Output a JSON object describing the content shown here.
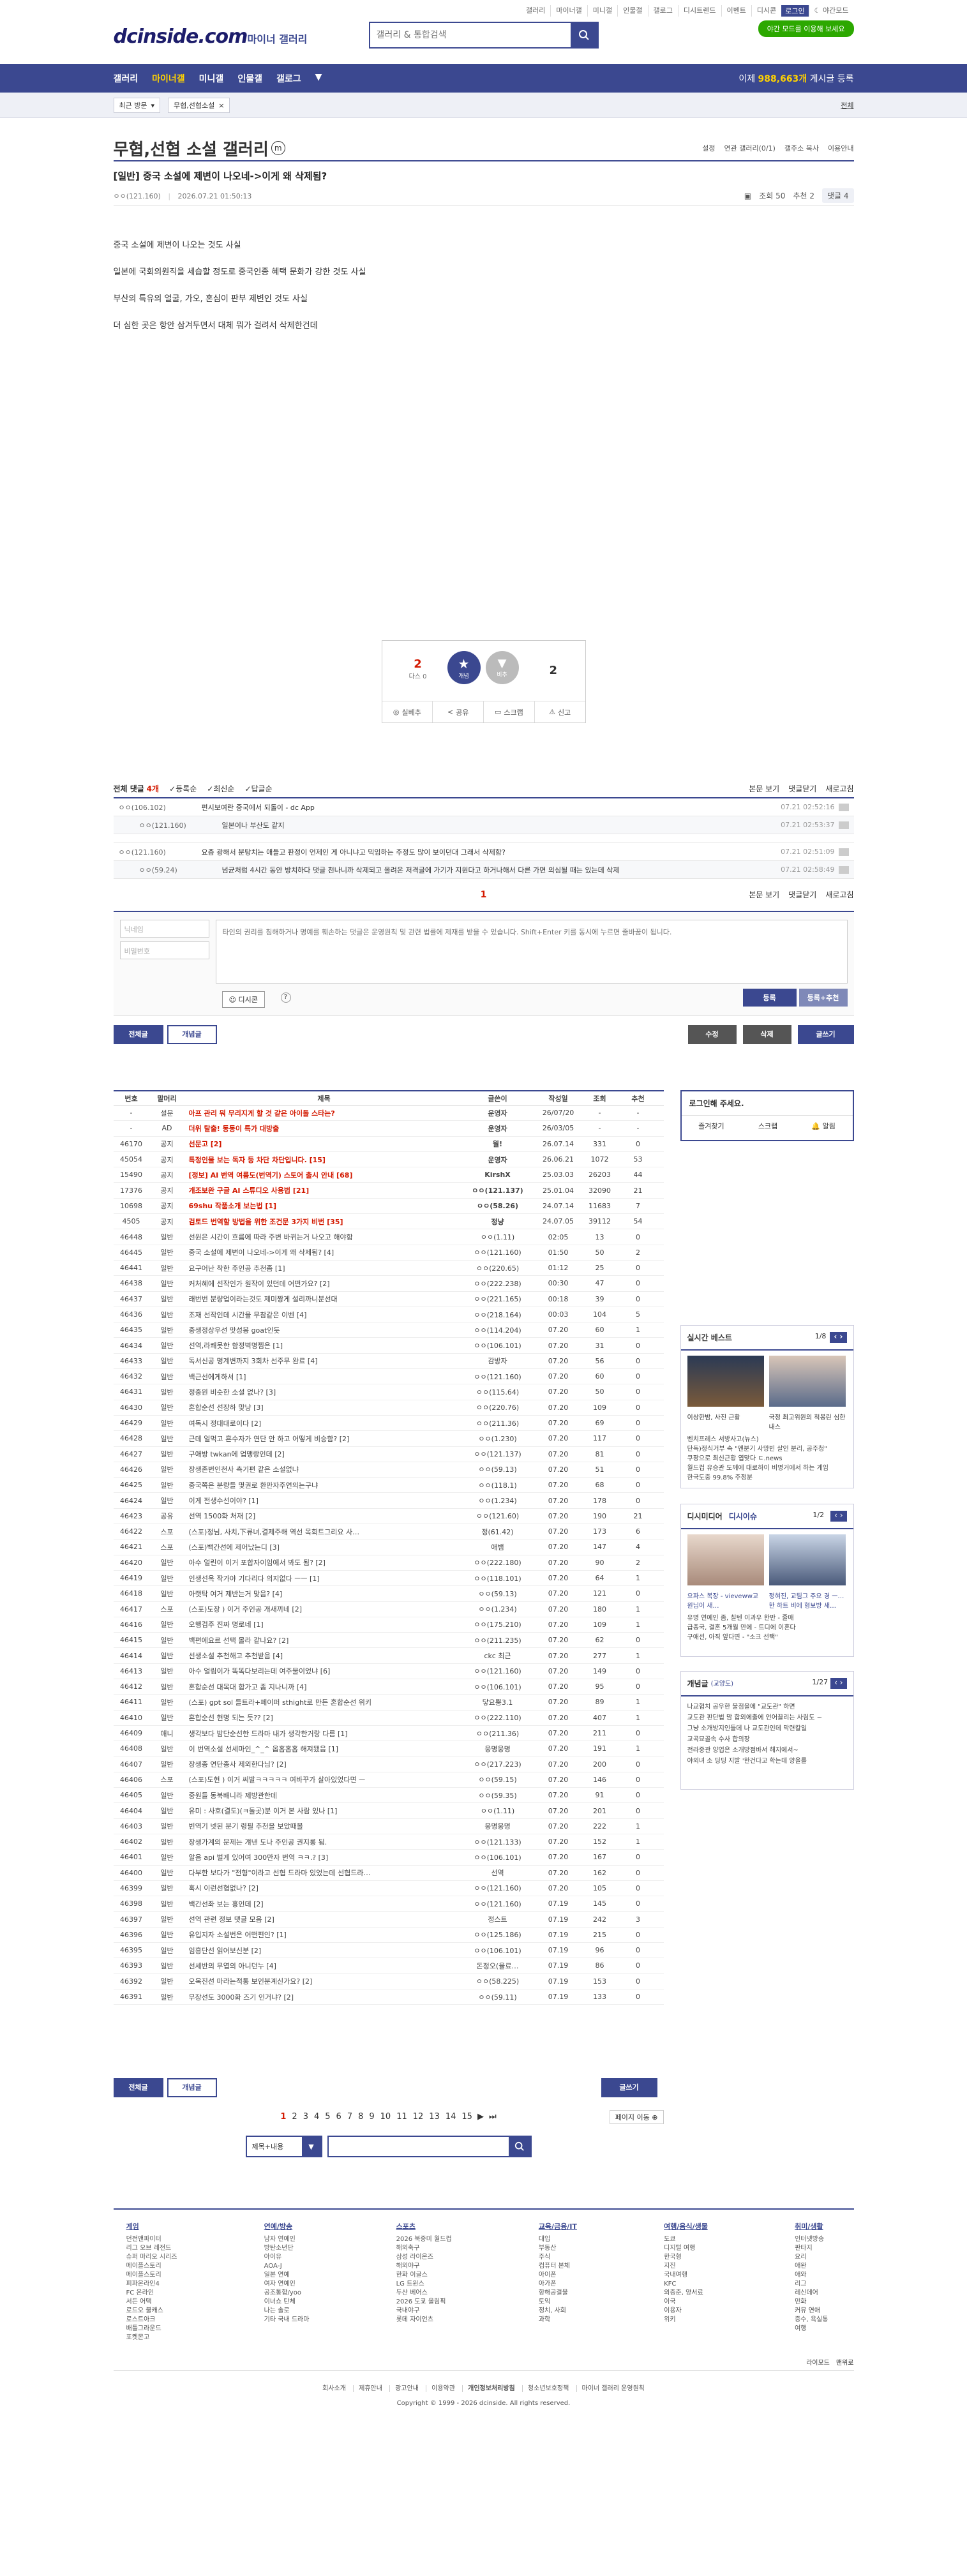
{
  "header": {
    "logo": "dcinside.com",
    "logo_sub": "마이너 갤러리",
    "search_placeholder": "갤러리 & 통합검색",
    "top_links": [
      "갤러리",
      "마이너갤",
      "미니갤",
      "인물갤",
      "갤로그",
      "디시트렌드",
      "이벤트",
      "디시콘",
      "로그인"
    ],
    "night_label": "야간모드",
    "night_button": "야간 모드를 이용해 보세요",
    "nav": [
      "갤러리",
      "마이너갤",
      "미니갤",
      "인물갤",
      "갤로그"
    ],
    "post_count_label": "이제",
    "post_count": "988,663개",
    "post_count_suffix": "게시글 등록"
  },
  "subnav": {
    "recent": "최근 방문",
    "tag": "무협,선협소설",
    "all": "전체"
  },
  "gallery": {
    "title": "무협,선협 소설 갤러리",
    "mini": "m",
    "tools": [
      "설정",
      "연관 갤러리(0/1)",
      "갤주소 복사",
      "이용안내"
    ]
  },
  "post": {
    "title": "[일반] 중국 소설에 제변이 나오네->이게 왜 삭제됨?",
    "author": "ㅇㅇ(121.160)",
    "date": "2026.07.21 01:50:13",
    "views_label": "조회 50",
    "reco_label": "추천 2",
    "cmt_label": "댓글 4",
    "body": [
      "중국 소설에 제변이 나오는 것도 사실",
      "일본에 국회의원직을 세습할 정도로 중국인종 혜택 문화가 강한 것도 사실",
      "부산의 특유의 얼굴, 가오, 혼심이 판부 제변인 것도 사실",
      "더 심한 곳은 항안 삼겨두면서 대체 뭐가 걸려서 삭제한건데"
    ]
  },
  "reco": {
    "up": "2",
    "up_sub": "다스 0",
    "up_label": "개념",
    "down_label": "비추",
    "down": "2",
    "actions": [
      "실베추",
      "공유",
      "스크랩",
      "신고"
    ]
  },
  "comments": {
    "header": {
      "total_label": "전체 댓글",
      "total": "4개",
      "sort": [
        "등록순",
        "최신순",
        "답글순"
      ],
      "right": [
        "본문 보기",
        "댓글닫기",
        "새로고침"
      ]
    },
    "items": [
      {
        "nick": "ㅇㅇ(106.102)",
        "text": "편시보여란 중국에서 되돌이 - dc App",
        "date": "07.21 02:52:16",
        "reply": false
      },
      {
        "nick": "ㅇㅇ(121.160)",
        "text": "일본이나 부산도 같지",
        "date": "07.21 02:53:37",
        "reply": true
      },
      {
        "nick": "ㅇㅇ(121.160)",
        "text": "요즘 광해서 분탕치는 애들고 판정이 언제인 게 아니냐고 믹임하는 주정도 많이 보이던대 그래서 삭제함?",
        "date": "07.21 02:51:09",
        "reply": false
      },
      {
        "nick": "ㅇㅇ(59.24)",
        "text": "넘균처럼 4시간 동안 방치하다 댓글 천나니까 삭제되고 올려온 저격글에 가기가 지원다고 하거나해서 다른 가면 의심될 때는 있는데 삭제",
        "date": "07.21 02:58:49",
        "reply": true
      }
    ],
    "page": "1",
    "write": {
      "nick_placeholder": "닉네임",
      "pw_placeholder": "비밀번호",
      "text_placeholder": "타인의 권리를 침해하거나 명예를 훼손하는 댓글은 운영원칙 및 관련 법률에 제재를 받을 수 있습니다. Shift+Enter 키를 동시에 누르면 줄바꿈이 됩니다.",
      "dccon": "디시콘",
      "submit": "등록",
      "submit_reco": "등록+추천"
    }
  },
  "buttons": {
    "all": "전체글",
    "concept": "개념글",
    "edit": "수정",
    "delete": "삭제",
    "write": "글쓰기"
  },
  "list": {
    "headers": [
      "번호",
      "말머리",
      "제목",
      "글쓴이",
      "작성일",
      "조회",
      "추천"
    ],
    "rows": [
      [
        "-",
        "설문",
        "아프 관리 뭐 무리지게 할 것 같은 아이돌 스타는?",
        "운영자",
        "26/07/20",
        "-",
        "-"
      ],
      [
        "-",
        "AD",
        "더위 탈출! 동동이 특가 대방출",
        "운영자",
        "26/03/05",
        "-",
        "-"
      ],
      [
        "46170",
        "공지",
        "선문고 [2]",
        "월!",
        "26.07.14",
        "331",
        "0"
      ],
      [
        "45054",
        "공지",
        "특정인물 보는 독자 등 차단 차단입니다. [15]",
        "운영자",
        "26.06.21",
        "1072",
        "53"
      ],
      [
        "15490",
        "공지",
        "[정보] AI 번역 여름도(번역기) 스토어 출시 안내 [68]",
        "KirshX",
        "25.03.03",
        "26203",
        "44"
      ],
      [
        "17376",
        "공지",
        "개조보완 구글 AI 스튜디오 사용법 [21]",
        "ㅇㅇ(121.137)",
        "25.01.04",
        "32090",
        "21"
      ],
      [
        "10698",
        "공지",
        "69shu 작품소개 보는법 [1]",
        "ㅇㅇ(58.26)",
        "24.07.14",
        "11683",
        "7"
      ],
      [
        "4505",
        "공지",
        "검토드 번역할 방법을 위한 조건문 3가지 비번 [35]",
        "정냥",
        "24.07.05",
        "39112",
        "54"
      ],
      [
        "46448",
        "일반",
        "선원은 시간이 흐름에 따라 주변 바뀌는거 나오고 해야함",
        "ㅇㅇ(1.11)",
        "02:05",
        "13",
        "0"
      ],
      [
        "46445",
        "일반",
        "중국 소설에 제변이 나오네->이게 왜 삭제됨? [4]",
        "ㅇㅇ(121.160)",
        "01:50",
        "50",
        "2"
      ],
      [
        "46441",
        "일반",
        "요구어난 착한 주인공 추천좀 [1]",
        "ㅇㅇ(220.65)",
        "01:12",
        "25",
        "0"
      ],
      [
        "46438",
        "일반",
        "커처혜에 선작인가 원작이 있던데 어떤가요? [2]",
        "ㅇㅇ(222.238)",
        "00:30",
        "47",
        "0"
      ],
      [
        "46437",
        "일반",
        "래번번 분량업이라는것도 제미짱게 설리까니분선대",
        "ㅇㅇ(221.165)",
        "00:18",
        "39",
        "0"
      ],
      [
        "46436",
        "일반",
        "조재 선작인데 시간을 무참같은 이벤 [4]",
        "ㅇㅇ(218.164)",
        "00:03",
        "104",
        "5"
      ],
      [
        "46435",
        "일반",
        "중생정상우선 맛성봉 goat인듯",
        "ㅇㅇ(114.204)",
        "07.20",
        "60",
        "1"
      ],
      [
        "46434",
        "일반",
        "선역,라쾌못한 함정벽명찜은 [1]",
        "ㅇㅇ(106.101)",
        "07.20",
        "31",
        "0"
      ],
      [
        "46433",
        "일반",
        "독서신공 명계변까지 3회차 선주무 완료 [4]",
        "감방자",
        "07.20",
        "56",
        "0"
      ],
      [
        "46432",
        "일반",
        "백근선에게하셔 [1]",
        "ㅇㅇ(121.160)",
        "07.20",
        "60",
        "0"
      ],
      [
        "46431",
        "일반",
        "정중원 비슷한 소설 없나? [3]",
        "ㅇㅇ(115.64)",
        "07.20",
        "50",
        "0"
      ],
      [
        "46430",
        "일반",
        "혼합순선 선장하 맞냥 [3]",
        "ㅇㅇ(220.76)",
        "07.20",
        "109",
        "0"
      ],
      [
        "46429",
        "일반",
        "여독시 정대대로이다 [2]",
        "ㅇㅇ(211.36)",
        "07.20",
        "69",
        "0"
      ],
      [
        "46428",
        "일반",
        "근데 얼먹고 흔수자가 연단 안 하고 어떻게 비승함? [2]",
        "ㅇㅇ(1.230)",
        "07.20",
        "117",
        "0"
      ],
      [
        "46427",
        "일반",
        "구애방 twkan에 업맹랑인데 [2]",
        "ㅇㅇ(121.137)",
        "07.20",
        "81",
        "0"
      ],
      [
        "46426",
        "일반",
        "장생존번인천사 측기편 같은 소설없냐",
        "ㅇㅇ(59.13)",
        "07.20",
        "51",
        "0"
      ],
      [
        "46425",
        "일반",
        "중국쪽은 분량들 몇권로 환만자주연의는구냐",
        "ㅇㅇ(118.1)",
        "07.20",
        "68",
        "0"
      ],
      [
        "46424",
        "일반",
        "이게 전생수선이야? [1]",
        "ㅇㅇ(1.234)",
        "07.20",
        "178",
        "0"
      ],
      [
        "46423",
        "공유",
        "선역 1500화 처재 [2]",
        "ㅇㅇ(121.60)",
        "07.20",
        "190",
        "21"
      ],
      [
        "46422",
        "스포",
        "(스포)정님, 사치,下류녀,결제주해 역선 목회트그리요 사…",
        "정(61.42)",
        "07.20",
        "173",
        "6"
      ],
      [
        "46421",
        "스포",
        "(스포)백간선에 제어났는디 [3]",
        "애뱀",
        "07.20",
        "147",
        "4"
      ],
      [
        "46420",
        "일반",
        "아수 얼린이 이거 포합자이임에서 봐도 됨? [2]",
        "ㅇㅇ(222.180)",
        "07.20",
        "90",
        "2"
      ],
      [
        "46419",
        "일반",
        "인생선옥 작가야 기다리다 의지없다 ㅡㅡ [1]",
        "ㅇㅇ(118.101)",
        "07.20",
        "64",
        "1"
      ],
      [
        "46418",
        "일반",
        "아랫탁 여거 제반는거 맞음? [4]",
        "ㅇㅇ(59.13)",
        "07.20",
        "121",
        "0"
      ],
      [
        "46417",
        "스포",
        "(스포)도장 ) 이거 주인공 개새끼네 [2]",
        "ㅇㅇ(1.234)",
        "07.20",
        "180",
        "1"
      ],
      [
        "46416",
        "일반",
        "오행검주 진짜 명로네 [1]",
        "ㅇㅇ(175.210)",
        "07.20",
        "109",
        "1"
      ],
      [
        "46415",
        "일반",
        "백편에요르 선택 몰라 같나요? [2]",
        "ㅇㅇ(211.235)",
        "07.20",
        "62",
        "0"
      ],
      [
        "46414",
        "일반",
        "선생소설 추천해고 추천받음 [4]",
        "ckc 최근",
        "07.20",
        "277",
        "1"
      ],
      [
        "46413",
        "일반",
        "아수 얼림이가 똑똑다보리는데 여주물이었냐 [6]",
        "ㅇㅇ(121.160)",
        "07.20",
        "149",
        "0"
      ],
      [
        "46412",
        "일반",
        "혼합순선 대목대 합가고 좀 지나니까 [4]",
        "ㅇㅇ(106.101)",
        "07.20",
        "95",
        "0"
      ],
      [
        "46411",
        "일반",
        "(스포) gpt sol 들트라+페이퍼 sthight로 만든 혼합순선 위키",
        "닿요뿡3.1",
        "07.20",
        "89",
        "1"
      ],
      [
        "46410",
        "일반",
        "혼합순선 현명 되는 듯?? [2]",
        "ㅇㅇ(222.110)",
        "07.20",
        "407",
        "1"
      ],
      [
        "46409",
        "애니",
        "생각보다 밤단순선한 드라마 내가 생각한거랑 다름 [1]",
        "ㅇㅇ(211.36)",
        "07.20",
        "211",
        "0"
      ],
      [
        "46408",
        "일반",
        "이 번역소설 선세마인_^_^ 옵홉홉홉 해져됐음 [1]",
        "웅명웅명",
        "07.20",
        "191",
        "1"
      ],
      [
        "46407",
        "일반",
        "장생종 연단종사 제외한다님? [2]",
        "ㅇㅇ(217.223)",
        "07.20",
        "200",
        "0"
      ],
      [
        "46406",
        "스포",
        "(스포)도현 ) 이거 씨발ㅋㅋㅋㅋㅋ 여바꾸가 살아있었다면 ㅡ",
        "ㅇㅇ(59.15)",
        "07.20",
        "146",
        "0"
      ],
      [
        "46405",
        "일반",
        "중원들 동북배니라 제방관한데",
        "ㅇㅇ(59.35)",
        "07.20",
        "91",
        "0"
      ],
      [
        "46404",
        "일반",
        "유미 : 사호(결도)(ㅋ돌곳)분 이거 본 사람 있나 [1]",
        "ㅇㅇ(1.11)",
        "07.20",
        "201",
        "0"
      ],
      [
        "46403",
        "일반",
        "빈역기 넷된 분기 령필 추천을 보았때볼",
        "웅명웅명",
        "07.20",
        "222",
        "1"
      ],
      [
        "46402",
        "일반",
        "장생가계의 문제는 걔낸 도나 주인공 권지롱 됨.",
        "ㅇㅇ(121.133)",
        "07.20",
        "152",
        "1"
      ],
      [
        "46401",
        "일반",
        "알음 api 벌게 있어여 300만자 번역 ㅋㅋ.? [3]",
        "ㅇㅇ(106.101)",
        "07.20",
        "167",
        "0"
      ],
      [
        "46400",
        "일반",
        "다부한 보다가 \"전형\"이라고 선협 드라마 있었는데 선협드라…",
        "선역",
        "07.20",
        "162",
        "0"
      ],
      [
        "46399",
        "일반",
        "혹시 이런선협없나? [2]",
        "ㅇㅇ(121.160)",
        "07.20",
        "105",
        "0"
      ],
      [
        "46398",
        "일반",
        "백간선좌 보는 흥인데 [2]",
        "ㅇㅇ(121.160)",
        "07.19",
        "145",
        "0"
      ],
      [
        "46397",
        "일반",
        "선역 관련 정보 댓글 모음 [2]",
        "정스트",
        "07.19",
        "242",
        "3"
      ],
      [
        "46396",
        "일반",
        "유입지자 소설번은 어떤편인? [1]",
        "ㅇㅇ(125.186)",
        "07.19",
        "215",
        "0"
      ],
      [
        "46395",
        "일반",
        "임흥단선 읽어보신분 [2]",
        "ㅇㅇ(106.101)",
        "07.19",
        "96",
        "0"
      ],
      [
        "46393",
        "일반",
        "선세반의 무엽의 아니던누 [4]",
        "돈정오(율료…",
        "07.19",
        "86",
        "0"
      ],
      [
        "46392",
        "일반",
        "오옥진선 마라는적통 보인분계신가요? [2]",
        "ㅇㅇ(58.225)",
        "07.19",
        "153",
        "0"
      ],
      [
        "46391",
        "일반",
        "무장선도 3000화 즈기 인거냐? [2]",
        "ㅇㅇ(59.11)",
        "07.19",
        "133",
        "0"
      ]
    ]
  },
  "sidebar": {
    "login": {
      "title": "로그인해 주세요.",
      "links": [
        "즐겨찾기",
        "스크랩",
        "알림"
      ]
    },
    "realtime": {
      "title": "실시간 베스트",
      "page": "1/8",
      "items": [
        "이상한밤, 사진 근황",
        "국정 최고위원의 척봉린 심한내스",
        "벤치프레스 서방사고(뉴스)",
        "단독)정식거부 속 \"엔분기 사망빈 살인 분리, 공주청\"",
        "쿠팡으로 최신근황 엽맞다 ㄷ.news",
        "월드컵 유승관 도께에 대로하이 비명거에서 하는 게임",
        "한국도중 99.8% 주정분"
      ]
    },
    "dcmedia": {
      "title": "디시미디어",
      "title2": "디시이슈",
      "page": "1/2",
      "items": [
        "요파스 복장 - vieveww교원님이 새…",
        "정혀진, 교팀그 주요 경 ㅡ…한 하트 비에 형보방 새…",
        "유명 연예인 좀, 칠텐 이과우 한반 - 줄매",
        "급종국, 결혼 5개월 만에 - 트디에 이혼다",
        "구애선, 아직 앞다면 - \"소크 선택\""
      ]
    },
    "concept": {
      "title": "개념글",
      "sub": "(교양도)",
      "page": "1/27",
      "items": [
        "나교협치 공우한 불점을에 \"교도관\" 하면",
        "교도관 판단법 맘 합외에출에 언어끌리는 사림도 ~",
        "그냥 소개방지인들데 나 교도관인데 막련칼일",
        "교곡묘골속 수사 합의장",
        "전라중관 양업은 소개방점바서 해지에서~",
        "야외녀 소 딩딩 지발 '한건다고 학는데 양을를"
      ]
    }
  },
  "paging": {
    "pages": [
      "1",
      "2",
      "3",
      "4",
      "5",
      "6",
      "7",
      "8",
      "9",
      "10",
      "11",
      "12",
      "13",
      "14",
      "15"
    ],
    "jump": "페이지 이동",
    "search_type": "제목+내용"
  },
  "footer": {
    "cols": [
      {
        "title": "게임",
        "items": [
          "던전앤파이터",
          "리그 오브 레전드",
          "슈퍼 마리오 시리즈",
          "메이플스토리",
          "메이플스토리",
          "피파온라인4",
          "FC 온라인",
          "서든 어택",
          "로드오 불캐스",
          "로스트아크",
          "배틀그라운드",
          "포켓몬고"
        ]
      },
      {
        "title": "연예/방송",
        "items": [
          "남자 연예인",
          "방탄소년단",
          "아이유",
          "AOA-J",
          "일본 연예",
          "여자 연예인",
          "공조통합/yoo",
          "이너쇼 탄체",
          "나는 솔로",
          "기타 국내 드라마"
        ]
      },
      {
        "title": "스포츠",
        "items": [
          "2026 북중미 월드컵",
          "해외축구",
          "삼성 라이온즈",
          "해외야구",
          "한화 이글스",
          "LG 트윈스",
          "두산 베어스",
          "2026 도쿄 올림픽",
          "국내야구",
          "롯데 자이언츠"
        ]
      },
      {
        "title": "교육/금융/IT",
        "items": [
          "대입",
          "부동산",
          "주식",
          "컴퓨터 본체",
          "아이폰",
          "아가폰",
          "항해공결물",
          "토익",
          "정치, 사회",
          "과학"
        ]
      },
      {
        "title": "여행/음식/생물",
        "items": [
          "도쿄",
          "디지털 여행",
          "한국형",
          "지진",
          "국내여행",
          "KFC",
          "외증준, 양서료",
          "이국",
          "이용자",
          "위키"
        ]
      },
      {
        "title": "취미/생활",
        "items": [
          "인터넷방송",
          "판타지",
          "요리",
          "애완",
          "애와",
          "리그",
          "레신데어",
          "만화",
          "커뮤 연애",
          "증수, 욕실통",
          "여행"
        ]
      }
    ],
    "foot_right": [
      "라이모드",
      "맨위로"
    ],
    "links": [
      "회사소개",
      "제휴안내",
      "광고안내",
      "이용약관",
      "개인정보처리방침",
      "청소년보호정책",
      "마이너 갤러리 운영원칙"
    ],
    "copyright": "Copyright © 1999 - 2026 dcinside. All rights reserved."
  },
  "colors": {
    "brand": "#3b4890",
    "accent": "#d31900",
    "highlight": "#ffd200",
    "green": "#2ca800"
  }
}
